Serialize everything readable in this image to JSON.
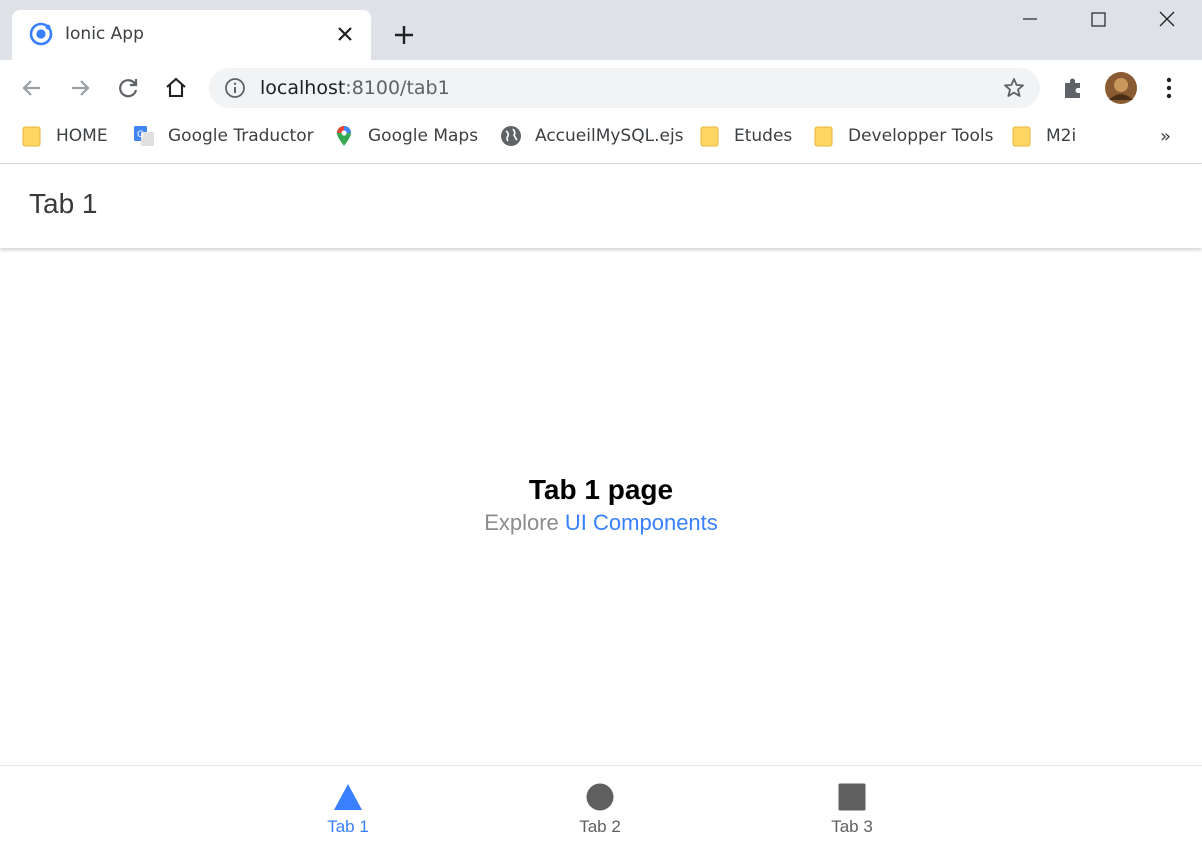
{
  "browser": {
    "tab_title": "Ionic App",
    "url_host": "localhost",
    "url_rest": ":8100/tab1",
    "accent": "#1a73e8"
  },
  "bookmarks": [
    {
      "label": "HOME",
      "icon": "folder-icon"
    },
    {
      "label": "Google Traductor",
      "icon": "google-translate-icon"
    },
    {
      "label": "Google Maps",
      "icon": "google-maps-icon"
    },
    {
      "label": "AccueilMySQL.ejs",
      "icon": "globe-icon"
    },
    {
      "label": "Etudes",
      "icon": "folder-icon"
    },
    {
      "label": "Developper Tools",
      "icon": "folder-icon"
    },
    {
      "label": "M2i",
      "icon": "folder-icon"
    }
  ],
  "bookmarks_overflow": "»",
  "app": {
    "header_title": "Tab 1",
    "page_heading": "Tab 1 page",
    "explore_text": "Explore ",
    "explore_link": "UI Components",
    "primary_color": "#3880ff",
    "muted_color": "#666666"
  },
  "tabs": [
    {
      "label": "Tab 1",
      "icon": "triangle-icon",
      "selected": true
    },
    {
      "label": "Tab 2",
      "icon": "ellipse-icon",
      "selected": false
    },
    {
      "label": "Tab 3",
      "icon": "square-icon",
      "selected": false
    }
  ]
}
